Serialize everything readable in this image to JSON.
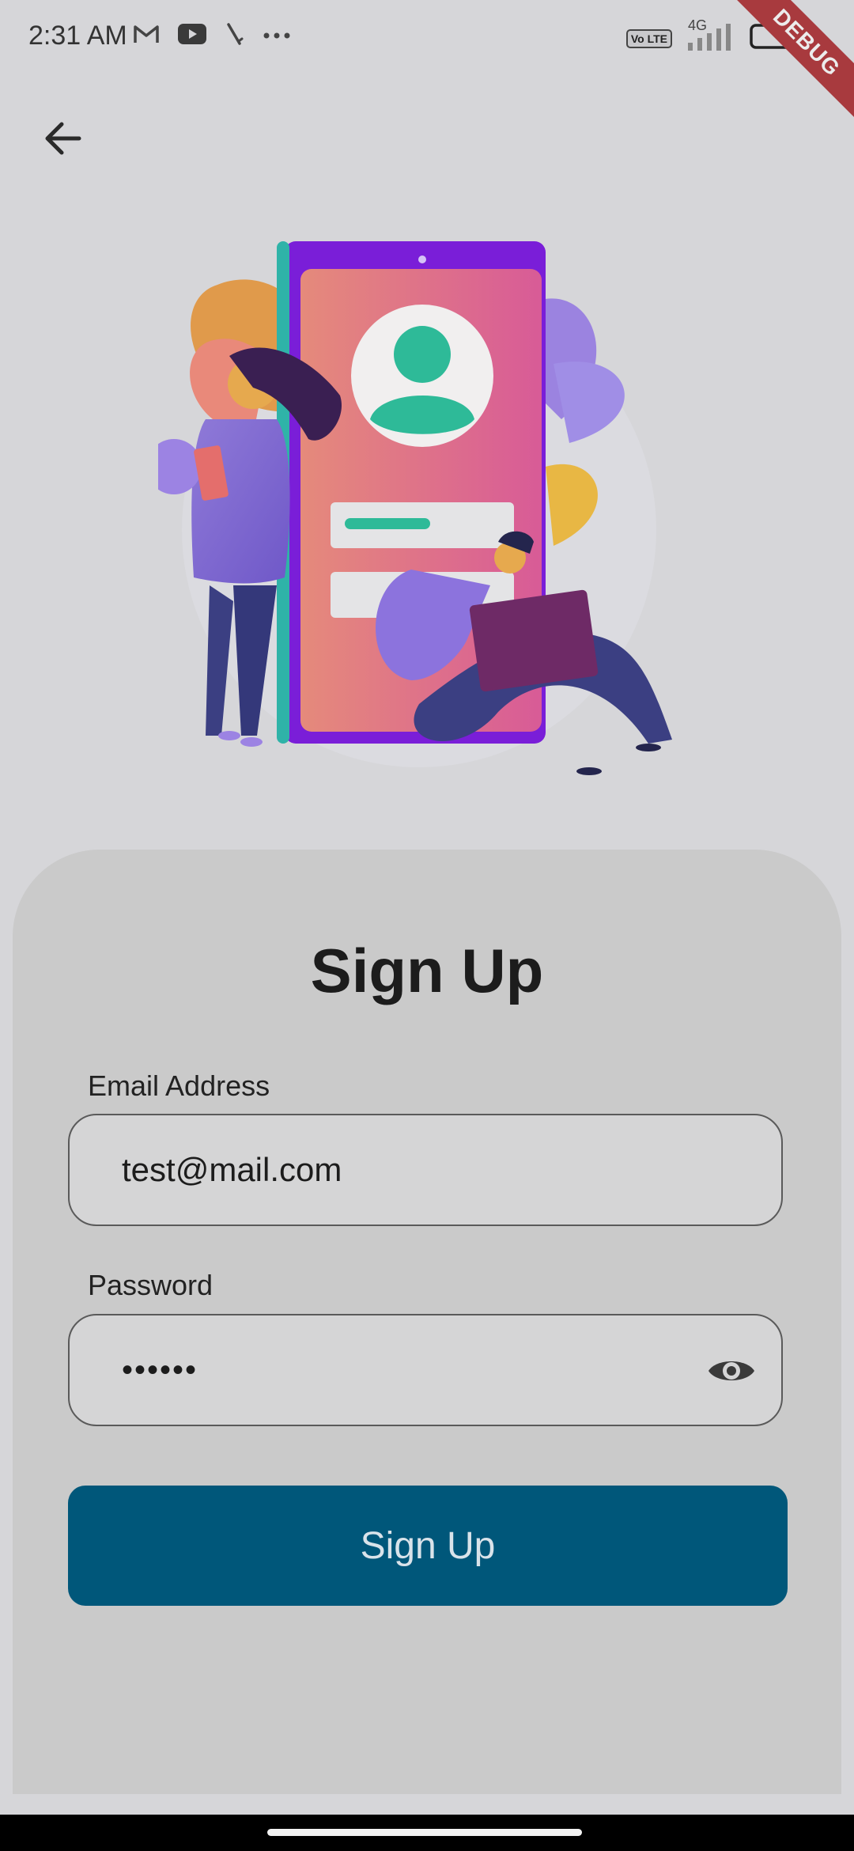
{
  "status_bar": {
    "time": "2:31 AM",
    "left_icons": [
      "gmail-icon",
      "youtube-icon",
      "edge-icon",
      "more-dots-icon"
    ],
    "right_icons": [
      "volte-icon",
      "signal-icon",
      "battery-icon"
    ],
    "volte_label": "Vo LTE",
    "network_label": "4G",
    "debug_banner": "DEBUG"
  },
  "header": {
    "back_icon": "arrow-left-icon"
  },
  "illustration": {
    "icon": "signup-illustration"
  },
  "form": {
    "title": "Sign Up",
    "email": {
      "label": "Email Address",
      "value": "test@mail.com"
    },
    "password": {
      "label": "Password",
      "value": "••••••",
      "toggle_icon": "eye-icon"
    },
    "submit_label": "Sign Up"
  },
  "colors": {
    "background": "#d6d6d9",
    "sheet": "#cacaca",
    "primary_button": "#00577a",
    "debug_banner": "#a83a3e"
  }
}
